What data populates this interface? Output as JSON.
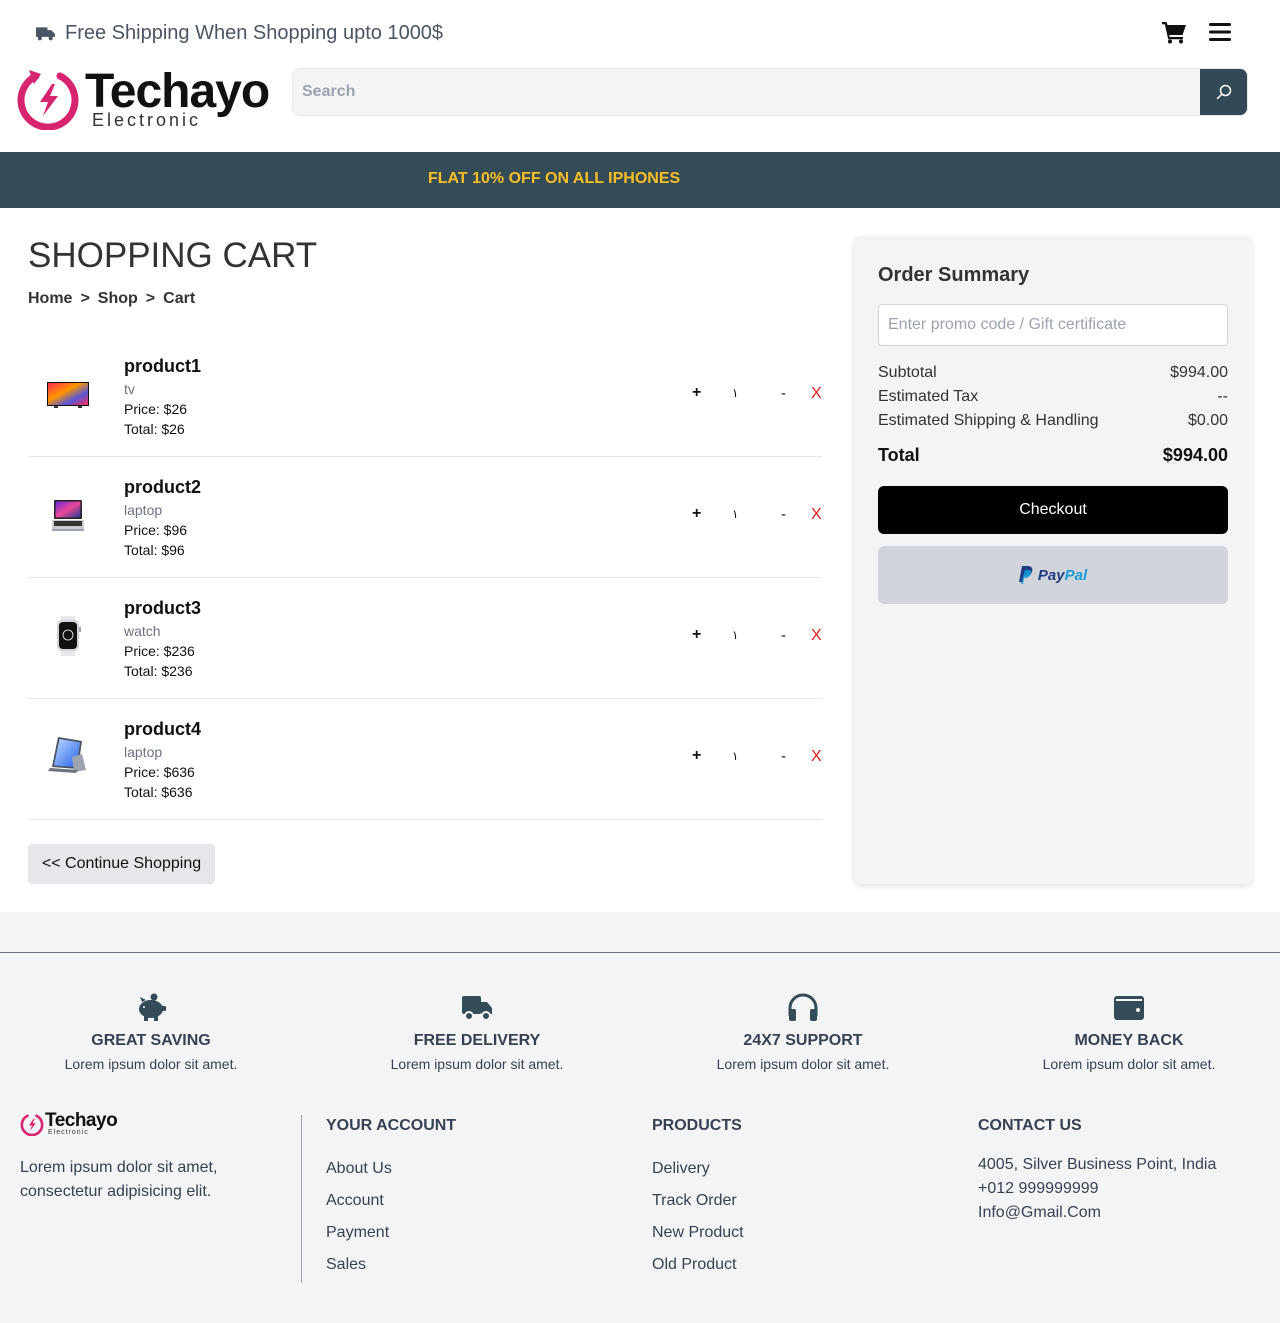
{
  "topbar": {
    "shipping_text": "Free Shipping When Shopping upto 1000$"
  },
  "brand": {
    "name": "Techayo",
    "tagline": "Electronic",
    "accent_color": "#d6246e"
  },
  "search": {
    "placeholder": "Search"
  },
  "promo_banner": {
    "text": "FLAT 10% OFF ON ALL IPHONES",
    "bg_color": "#344b58",
    "text_color": "#fbbf24"
  },
  "cart": {
    "title": "SHOPPING CART",
    "breadcrumb": [
      "Home",
      ">",
      "Shop",
      ">",
      "Cart"
    ],
    "items": [
      {
        "name": "product1",
        "category": "tv",
        "price": "Price: $26",
        "total": "Total: $26",
        "qty": "١",
        "plus": "+",
        "minus": "-",
        "remove": "X",
        "icon": "tv-image"
      },
      {
        "name": "product2",
        "category": "laptop",
        "price": "Price: $96",
        "total": "Total: $96",
        "qty": "١",
        "plus": "+",
        "minus": "-",
        "remove": "X",
        "icon": "laptop-image"
      },
      {
        "name": "product3",
        "category": "watch",
        "price": "Price: $236",
        "total": "Total: $236",
        "qty": "١",
        "plus": "+",
        "minus": "-",
        "remove": "X",
        "icon": "watch-image"
      },
      {
        "name": "product4",
        "category": "laptop",
        "price": "Price: $636",
        "total": "Total: $636",
        "qty": "١",
        "plus": "+",
        "minus": "-",
        "remove": "X",
        "icon": "tablet-image"
      }
    ],
    "continue_label": "<< Continue Shopping"
  },
  "summary": {
    "title": "Order Summary",
    "promo_placeholder": "Enter promo code / Gift certificate",
    "subtotal_label": "Subtotal",
    "subtotal_value": "$994.00",
    "tax_label": "Estimated Tax",
    "tax_value": "--",
    "shipping_label": "Estimated Shipping & Handling",
    "shipping_value": "$0.00",
    "total_label": "Total",
    "total_value": "$994.00",
    "checkout_label": "Checkout",
    "paypal_pay": "Pay",
    "paypal_pal": "Pal"
  },
  "footer": {
    "features": [
      {
        "title": "GREAT SAVING",
        "text": "Lorem ipsum dolor sit amet.",
        "icon": "piggy-bank-icon"
      },
      {
        "title": "FREE DELIVERY",
        "text": "Lorem ipsum dolor sit amet.",
        "icon": "truck-icon"
      },
      {
        "title": "24X7 SUPPORT",
        "text": "Lorem ipsum dolor sit amet.",
        "icon": "headphones-icon"
      },
      {
        "title": "MONEY BACK",
        "text": "Lorem ipsum dolor sit amet.",
        "icon": "wallet-icon"
      }
    ],
    "about": "Lorem ipsum dolor sit amet, consectetur adipisicing elit.",
    "your_account": {
      "title": "YOUR ACCOUNT",
      "links": [
        "About Us",
        "Account",
        "Payment",
        "Sales"
      ]
    },
    "products": {
      "title": "PRODUCTS",
      "links": [
        "Delivery",
        "Track Order",
        "New Product",
        "Old Product"
      ]
    },
    "contact": {
      "title": "CONTACT US",
      "address": "4005, Silver Business Point, India",
      "phone": "+012 999999999",
      "email": "Info@Gmail.Com"
    }
  }
}
